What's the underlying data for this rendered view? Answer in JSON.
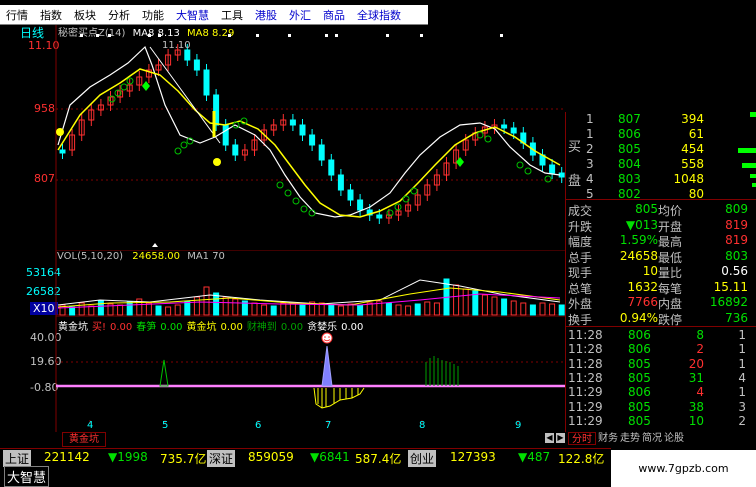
{
  "menu": [
    "行情",
    "指数",
    "板块",
    "分析",
    "功能",
    "大智慧",
    "工具",
    "港股",
    "外汇",
    "商品",
    "全球指数"
  ],
  "menu_colors": {
    "大智慧": "#0000cc",
    "港股": "#0000cc",
    "外汇": "#0000cc",
    "商品": "#0000cc",
    "全球指数": "#0000cc"
  },
  "period_label": "日线",
  "indicator_header": {
    "name": "秘密买点Z(14)",
    "ma1": "MA8 8.13",
    "ma2": "MA8 8.29"
  },
  "price_axis": {
    "high": "11.10",
    "mid": "958",
    "low": "807"
  },
  "peak_label": "11.10",
  "vol_header": {
    "name": "VOL(5,10,20)",
    "value": "24658.00",
    "ma": "MA1 70"
  },
  "vol_axis": [
    "53164",
    "26582",
    "X10"
  ],
  "osc_header": [
    {
      "text": "黄金坑",
      "color": "#ffffff"
    },
    {
      "text": "买!",
      "color": "#ff3030"
    },
    {
      "text": "0.00",
      "color": "#ff3030"
    },
    {
      "text": "春笋",
      "color": "#00e000"
    },
    {
      "text": "0.00",
      "color": "#00e000"
    },
    {
      "text": "黄金坑",
      "color": "#ffff00"
    },
    {
      "text": "0.00",
      "color": "#ffff00"
    },
    {
      "text": "财神到",
      "color": "#00a000"
    },
    {
      "text": "0.00",
      "color": "#00a000"
    },
    {
      "text": "贪婪乐",
      "color": "#ffffff"
    },
    {
      "text": "0.00",
      "color": "#ffffff"
    }
  ],
  "osc_axis": [
    "40.00",
    "19.60",
    "-0.80"
  ],
  "x_ticks": [
    "4",
    "5",
    "6",
    "7",
    "8",
    "9"
  ],
  "tab_label": "黄金坑",
  "tab_right": "分时",
  "order_book": [
    {
      "side": "",
      "level": "1",
      "price": "807",
      "vol": "394"
    },
    {
      "side": "买",
      "level": "1",
      "price": "806",
      "vol": "61"
    },
    {
      "side": "",
      "level": "2",
      "price": "805",
      "vol": "454"
    },
    {
      "side": "",
      "level": "3",
      "price": "804",
      "vol": "558"
    },
    {
      "side": "盘",
      "level": "4",
      "price": "803",
      "vol": "1048"
    },
    {
      "side": "",
      "level": "5",
      "price": "802",
      "vol": "80"
    }
  ],
  "stats": [
    {
      "l1": "成交",
      "v1": "805",
      "l2": "均价",
      "v2": "809",
      "c1": "#00e000",
      "c2": "#00e000"
    },
    {
      "l1": "升跌",
      "v1": "▼013",
      "l2": "开盘",
      "v2": "819",
      "c1": "#00e000",
      "c2": "#ff3030"
    },
    {
      "l1": "幅度",
      "v1": "1.59%",
      "l2": "最高",
      "v2": "819",
      "c1": "#00e000",
      "c2": "#ff3030"
    },
    {
      "l1": "总手",
      "v1": "24658",
      "l2": "最低",
      "v2": "803",
      "c1": "#ffff00",
      "c2": "#00e000"
    },
    {
      "l1": "现手",
      "v1": "10",
      "l2": "量比",
      "v2": "0.56",
      "c1": "#ffff00",
      "c2": "#ffffff"
    },
    {
      "l1": "总笔",
      "v1": "1632",
      "l2": "每笔",
      "v2": "15.11",
      "c1": "#ffff00",
      "c2": "#ffff00"
    },
    {
      "l1": "外盘",
      "v1": "7766",
      "l2": "内盘",
      "v2": "16892",
      "c1": "#ff3030",
      "c2": "#00e000"
    },
    {
      "l1": "换手",
      "v1": "0.94%",
      "l2": "跌停",
      "v2": "736",
      "c1": "#ffff00",
      "c2": "#00e000"
    }
  ],
  "ticks": [
    {
      "time": "11:28",
      "price": "806",
      "vol": "8",
      "n": "1",
      "pc": "#00e000",
      "vc": "#00e000"
    },
    {
      "time": "11:28",
      "price": "806",
      "vol": "2",
      "n": "1",
      "pc": "#00e000",
      "vc": "#ff3030"
    },
    {
      "time": "11:28",
      "price": "805",
      "vol": "20",
      "n": "1",
      "pc": "#00e000",
      "vc": "#ff3030"
    },
    {
      "time": "11:28",
      "price": "805",
      "vol": "31",
      "n": "4",
      "pc": "#00e000",
      "vc": "#00e000"
    },
    {
      "time": "11:29",
      "price": "806",
      "vol": "4",
      "n": "1",
      "pc": "#00e000",
      "vc": "#ff3030"
    },
    {
      "time": "11:29",
      "price": "805",
      "vol": "38",
      "n": "3",
      "pc": "#00e000",
      "vc": "#00e000"
    },
    {
      "time": "11:29",
      "price": "805",
      "vol": "10",
      "n": "2",
      "pc": "#00e000",
      "vc": "#00e000"
    }
  ],
  "right_tabs": [
    "财务",
    "走势",
    "简况",
    "论股"
  ],
  "bottom": {
    "sh_label": "上证",
    "sh_val": "221142",
    "sh_chg": "▼1998",
    "sh_amt": "735.7亿",
    "sz_label": "深证",
    "sz_val": "859059",
    "sz_chg": "▼6841",
    "sz_amt": "587.4亿",
    "cy_label": "创业",
    "cy_val": "127393",
    "cy_chg": "▼487",
    "cy_amt": "122.8亿"
  },
  "brand": "大智慧",
  "watermark": "www.7gpzb.com"
}
